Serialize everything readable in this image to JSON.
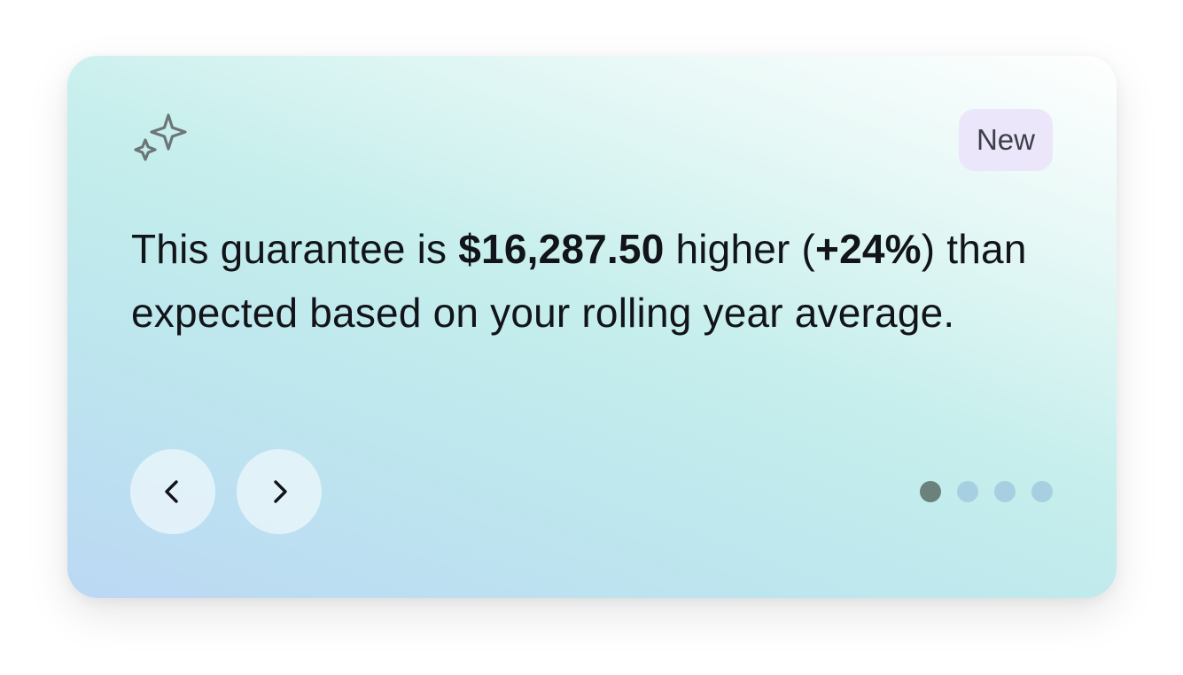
{
  "insight_card": {
    "icon": "sparkles-icon",
    "badge_label": "New",
    "message": {
      "part1": "This guarantee is ",
      "amount": "$16,287.50",
      "part2": " higher (",
      "percent": "+24%",
      "part3": ") than expected based on your rolling year average."
    },
    "prev_icon": "chevron-left-icon",
    "next_icon": "chevron-right-icon",
    "pagination": {
      "total": 4,
      "active_index": 0
    },
    "colors": {
      "badge_bg": "#ece6fb",
      "dot_active": "#6c807c",
      "dot_inactive": "#a6d0e2"
    }
  }
}
